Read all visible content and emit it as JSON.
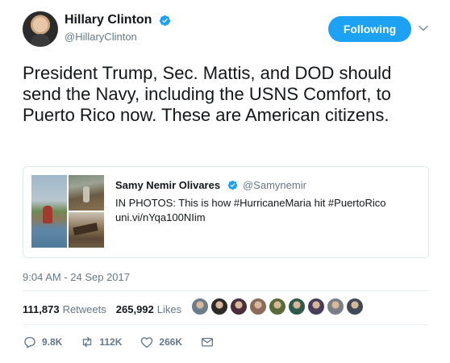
{
  "header": {
    "display_name": "Hillary Clinton",
    "handle": "@HillaryClinton",
    "follow_label": "Following"
  },
  "tweet": {
    "text": "President Trump, Sec. Mattis, and DOD should send the Navy, including the USNS Comfort, to Puerto Rico now. These are American citizens."
  },
  "quote": {
    "name": "Samy Nemir Olivares",
    "handle": "@Samynemir",
    "text_line1": "IN PHOTOS: This is how #HurricaneMaria hit #PuertoRico",
    "text_line2": "uni.vi/nYqa100NIim"
  },
  "timestamp": "9:04 AM - 24 Sep 2017",
  "stats": {
    "retweets_count": "111,873",
    "retweets_label": "Retweets",
    "likes_count": "265,992",
    "likes_label": "Likes"
  },
  "likers": {
    "count_shown": 9,
    "colors": [
      "#6b7c8a",
      "#2f2a26",
      "#4a2f3a",
      "#8c6b5a",
      "#5a6a3a",
      "#2f5a4a",
      "#4a3f5a",
      "#7a7f86",
      "#3f4a55"
    ]
  },
  "actions": {
    "reply_count": "9.8K",
    "retweet_count": "112K",
    "like_count": "266K"
  },
  "icons": {
    "verified": "verified-badge-icon",
    "chevron": "chevron-down-icon",
    "reply": "reply-icon",
    "retweet": "retweet-icon",
    "like": "heart-icon",
    "dm": "envelope-icon"
  },
  "colors": {
    "accent": "#1da1f2",
    "text_primary": "#14171a",
    "text_secondary": "#657786",
    "border": "#e1e8ed"
  }
}
